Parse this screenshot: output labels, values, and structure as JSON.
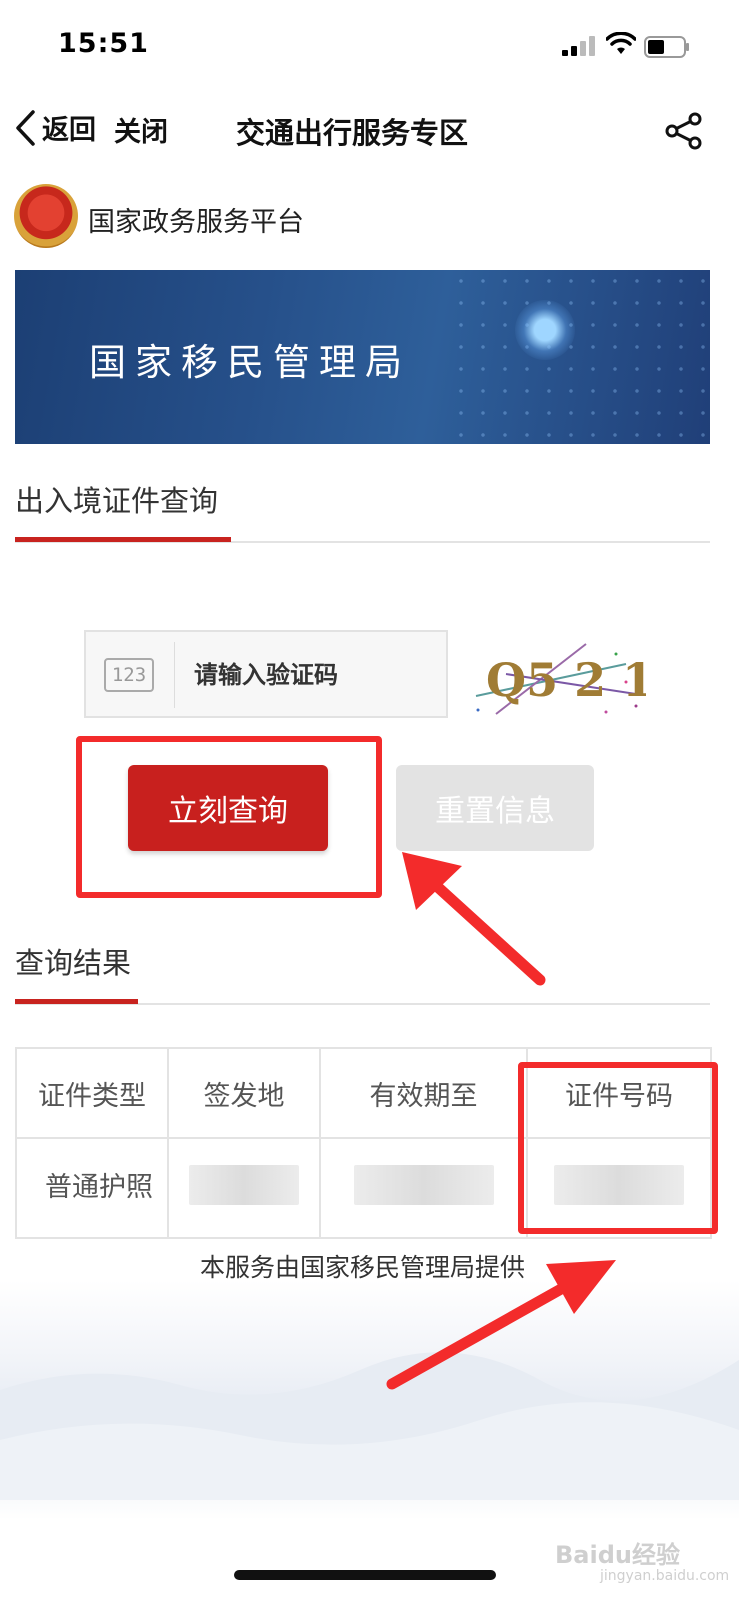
{
  "status_bar": {
    "time": "15:51"
  },
  "nav": {
    "back_label": "返回",
    "close_label": "关闭",
    "title": "交通出行服务专区"
  },
  "header": {
    "platform_name": "国家政务服务平台"
  },
  "banner": {
    "title": "国家移民管理局"
  },
  "query_section": {
    "title": "出入境证件查询",
    "captcha_icon_text": "123",
    "captcha_placeholder": "请输入验证码",
    "captcha_image_text": "Q5 2 1",
    "query_button": "立刻查询",
    "reset_button": "重置信息"
  },
  "results_section": {
    "title": "查询结果",
    "columns": [
      "证件类型",
      "签发地",
      "有效期至",
      "证件号码"
    ],
    "rows": [
      [
        "普通护照"
      ]
    ]
  },
  "footer": {
    "provider_text": "本服务由国家移民管理局提供"
  },
  "watermark": {
    "brand": "Baidu经验",
    "url": "jingyan.baidu.com"
  },
  "colors": {
    "accent": "#c8201e",
    "annotation": "#f32b2b",
    "banner": "#26508a"
  }
}
